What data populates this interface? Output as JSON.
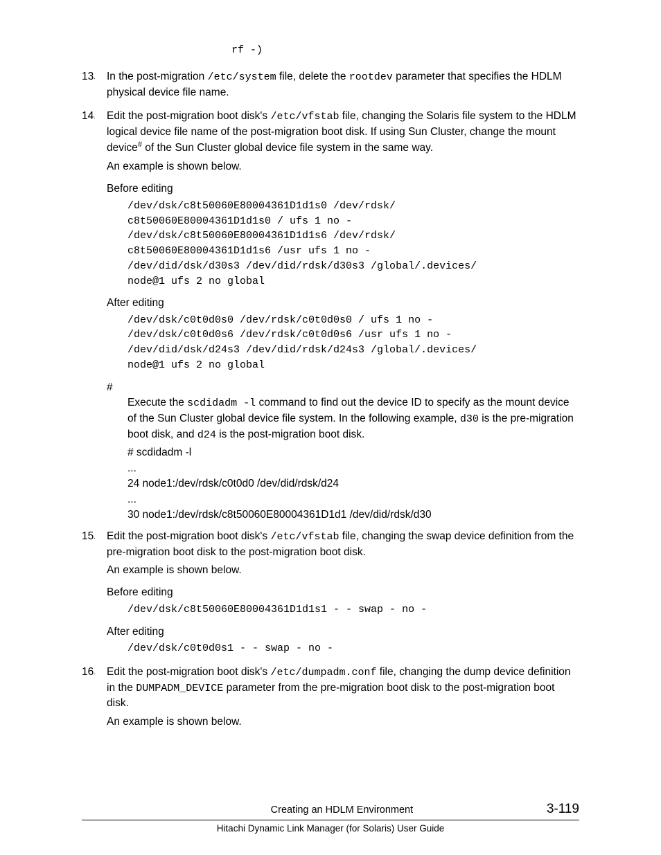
{
  "frag_line": "rf -)",
  "steps": {
    "s13": {
      "num": "13",
      "t1": "In the post-migration ",
      "c1": "/etc/system",
      "t2": " file, delete the ",
      "c2": "rootdev",
      "t3": " parameter that specifies the HDLM physical device file name."
    },
    "s14": {
      "num": "14",
      "t1": "Edit the post-migration boot disk's ",
      "c1": "/etc/vfstab",
      "t2": " file, changing the Solaris file system to the HDLM logical device file name of the post-migration boot disk. If using Sun Cluster, change the mount device",
      "sup": "#",
      "t3": " of the Sun Cluster global device file system in the same way.",
      "example": "An example is shown below.",
      "before_label": "Before editing",
      "before_lines": [
        "/dev/dsk/c8t50060E80004361D1d1s0 /dev/rdsk/",
        "c8t50060E80004361D1d1s0 / ufs 1 no -",
        "/dev/dsk/c8t50060E80004361D1d1s6 /dev/rdsk/",
        "c8t50060E80004361D1d1s6 /usr ufs 1 no -",
        "/dev/did/dsk/d30s3 /dev/did/rdsk/d30s3 /global/.devices/",
        "node@1 ufs 2 no global"
      ],
      "after_label": "After editing",
      "after_lines": [
        "/dev/dsk/c0t0d0s0 /dev/rdsk/c0t0d0s0 / ufs 1 no -",
        "/dev/dsk/c0t0d0s6 /dev/rdsk/c0t0d0s6 /usr ufs 1 no -",
        "/dev/did/dsk/d24s3 /dev/did/rdsk/d24s3 /global/.devices/",
        "node@1 ufs 2 no global"
      ],
      "hash": "#",
      "hash_t1": "Execute the ",
      "hash_c1": "scdidadm -l",
      "hash_t2": " command to find out the device ID to specify as the mount device of the Sun Cluster global device file system. In the following example, ",
      "hash_c2": "d30",
      "hash_t3": " is the pre-migration boot disk, and ",
      "hash_c3": "d24",
      "hash_t4": " is the post-migration boot disk.",
      "hash_lines": [
        "# scdidadm -l",
        "...",
        "24 node1:/dev/rdsk/c0t0d0 /dev/did/rdsk/d24",
        "...",
        "30 node1:/dev/rdsk/c8t50060E80004361D1d1 /dev/did/rdsk/d30"
      ]
    },
    "s15": {
      "num": "15",
      "t1": "Edit the post-migration boot disk's ",
      "c1": "/etc/vfstab",
      "t2": " file, changing the swap device definition from the pre-migration boot disk to the post-migration boot disk.",
      "example": "An example is shown below.",
      "before_label": "Before editing",
      "before_lines": [
        "/dev/dsk/c8t50060E80004361D1d1s1 - - swap - no -"
      ],
      "after_label": "After editing",
      "after_lines": [
        "/dev/dsk/c0t0d0s1 - - swap - no -"
      ]
    },
    "s16": {
      "num": "16",
      "t1": "Edit the post-migration boot disk's ",
      "c1": "/etc/dumpadm.conf",
      "t2": " file, changing the dump device definition in the ",
      "c2": "DUMPADM_DEVICE",
      "t3": " parameter from the pre-migration boot disk to the post-migration boot disk.",
      "example": "An example is shown below."
    }
  },
  "footer": {
    "center": "Creating an HDLM Environment",
    "right": "3-119",
    "sub": "Hitachi Dynamic Link Manager (for Solaris) User Guide"
  }
}
